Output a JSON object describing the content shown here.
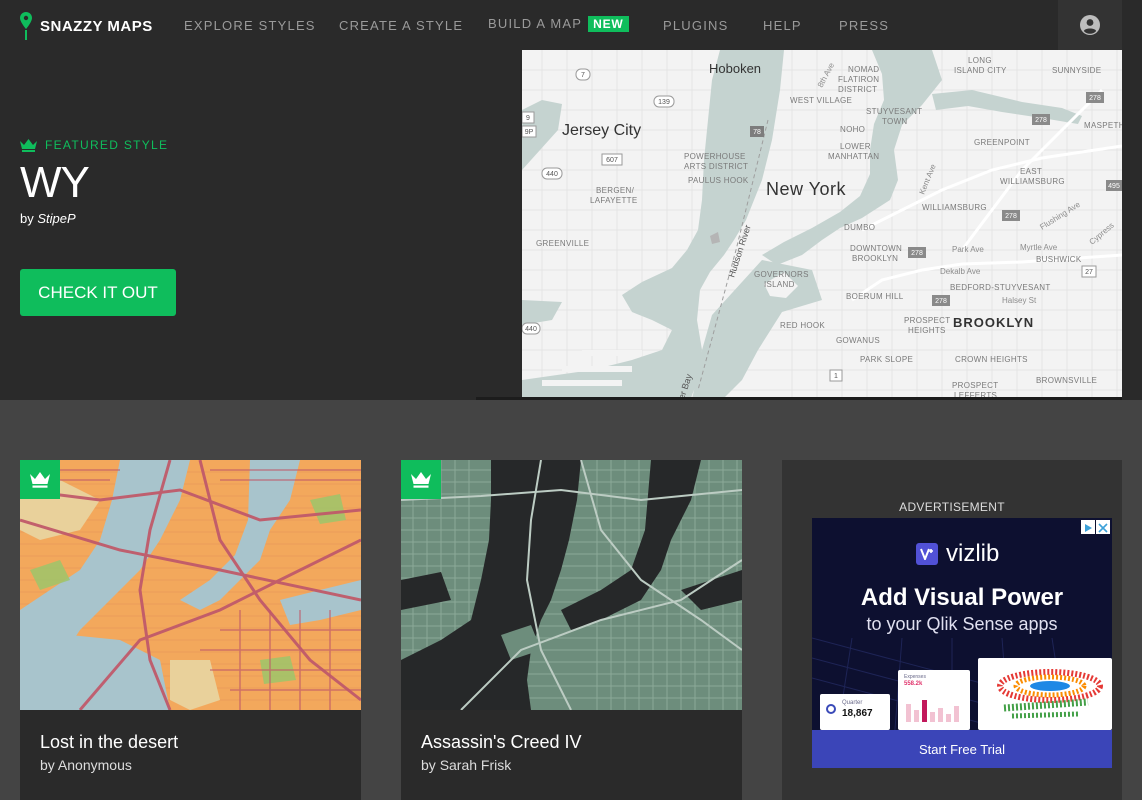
{
  "brand": {
    "name": "SNAZZY MAPS"
  },
  "nav": {
    "explore": "EXPLORE STYLES",
    "create": "CREATE A STYLE",
    "build": "BUILD A MAP",
    "new_badge": "NEW",
    "plugins": "PLUGINS",
    "help": "HELP",
    "press": "PRESS"
  },
  "hero": {
    "featured_label": "FEATURED STYLE",
    "title": "WY",
    "by_prefix": "by",
    "author": "StipeP",
    "cta": "CHECK IT OUT",
    "map_labels": {
      "hoboken": "Hoboken",
      "jersey_city": "Jersey City",
      "new_york": "New York",
      "brooklyn": "BROOKLYN",
      "nomad": "NOMAD",
      "flatiron": "FLATIRON",
      "district": "DISTRICT",
      "west_village": "WEST VILLAGE",
      "stuyvesant": "STUYVESANT",
      "town": "TOWN",
      "noho": "NOHO",
      "lower": "LOWER",
      "manhattan": "MANHATTAN",
      "powerhouse": "POWERHOUSE",
      "arts_district": "ARTS DISTRICT",
      "paulus_hook": "PAULUS HOOK",
      "bergen": "BERGEN/",
      "lafayette": "LAFAYETTE",
      "greenville": "GREENVILLE",
      "hudson_river": "Hudson River",
      "governors": "GOVERNORS",
      "island": "ISLAND",
      "dumbo": "DUMBO",
      "downtown": "DOWNTOWN",
      "brooklyn_small": "BROOKLYN",
      "boerum_hill": "BOERUM HILL",
      "red_hook": "RED HOOK",
      "prospect": "PROSPECT",
      "heights": "HEIGHTS",
      "gowanus": "GOWANUS",
      "park_slope": "PARK SLOPE",
      "crown_heights": "CROWN HEIGHTS",
      "prospect2": "PROSPECT",
      "lefferts": "LEFFERTS",
      "long": "LONG",
      "island_city": "ISLAND CITY",
      "sunnyside": "SUNNYSIDE",
      "greenpoint": "GREENPOINT",
      "east": "EAST",
      "williamsburg_e": "WILLIAMSBURG",
      "williamsburg": "WILLIAMSBURG",
      "maspeth": "MASPETH",
      "bushwick": "BUSHWICK",
      "bedford": "BEDFORD-STUYVESANT",
      "brownsville": "BROWNSVILLE",
      "flushing_ave": "Flushing Ave",
      "park_ave": "Park Ave",
      "myrtle_ave": "Myrtle Ave",
      "dekalb_ave": "Dekalb Ave",
      "halsey_st": "Halsey St",
      "kent_ave": "Kent Ave",
      "eighth_ave": "8th Ave",
      "cypress": "Cypress",
      "bay": "er Bay",
      "r7": "7",
      "r139": "139",
      "r78": "78",
      "r607": "607",
      "r440a": "440",
      "r440b": "440",
      "r278a": "278",
      "r278b": "278",
      "r278c": "278",
      "r278d": "278",
      "r278e": "278",
      "r9": "9",
      "r27": "27",
      "r495": "495",
      "r1": "1",
      "r9p": "9P"
    }
  },
  "cards": [
    {
      "title": "Lost in the desert",
      "by_prefix": "by",
      "author": "Anonymous"
    },
    {
      "title": "Assassin's Creed IV",
      "by_prefix": "by",
      "author": "Sarah Frisk"
    }
  ],
  "ad": {
    "label": "ADVERTISEMENT",
    "brand": "vizlib",
    "headline": "Add Visual Power",
    "subhead": "to your Qlik Sense apps",
    "cta": "Start Free Trial",
    "tile_value": "18,867",
    "tile_caption": "Quarter",
    "tile2_title": "Expenses",
    "tile2_value": "558.2k"
  },
  "colors": {
    "accent": "#0fbd5c",
    "nav_bg": "#2a2a2a",
    "page_bg": "#444444"
  }
}
